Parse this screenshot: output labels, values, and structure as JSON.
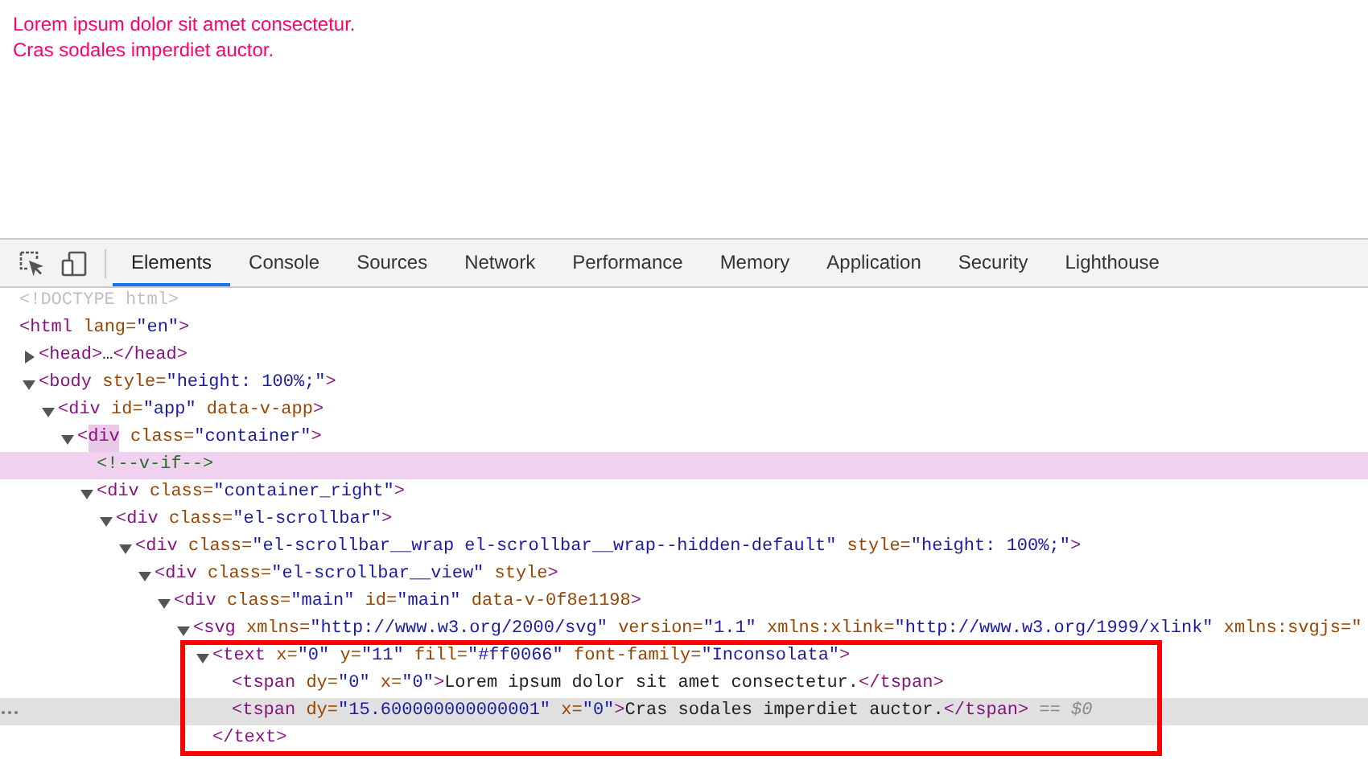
{
  "preview": {
    "lines": [
      "Lorem ipsum dolor sit amet consectetur.",
      "Cras sodales imperdiet auctor."
    ]
  },
  "devtools": {
    "tabs": [
      {
        "label": "Elements",
        "selected": true
      },
      {
        "label": "Console",
        "selected": false
      },
      {
        "label": "Sources",
        "selected": false
      },
      {
        "label": "Network",
        "selected": false
      },
      {
        "label": "Performance",
        "selected": false
      },
      {
        "label": "Memory",
        "selected": false
      },
      {
        "label": "Application",
        "selected": false
      },
      {
        "label": "Security",
        "selected": false
      },
      {
        "label": "Lighthouse",
        "selected": false
      }
    ],
    "nodes": [
      {
        "tokens": [
          {
            "kind": "doctype",
            "text": "<!DOCTYPE html>"
          }
        ],
        "selected": false,
        "hovered": false
      },
      {
        "tokens": [
          {
            "kind": "tag",
            "text": "<html"
          },
          {
            "kind": "attr",
            "text": " lang="
          },
          {
            "kind": "value",
            "text": "\"en\""
          },
          {
            "kind": "tag",
            "text": ">"
          }
        ],
        "selected": false,
        "hovered": false,
        "children": [
          {
            "tokens": [
              {
                "kind": "tag",
                "text": "<head>"
              },
              {
                "kind": "text",
                "text": "…"
              },
              {
                "kind": "tag",
                "text": "</head>"
              }
            ],
            "expanded": false,
            "selected": false,
            "hovered": false
          },
          {
            "tokens": [
              {
                "kind": "tag",
                "text": "<body"
              },
              {
                "kind": "attr",
                "text": " style="
              },
              {
                "kind": "value",
                "text": "\"height: 100%;\""
              },
              {
                "kind": "tag",
                "text": ">"
              }
            ],
            "expanded": true,
            "selected": false,
            "hovered": false,
            "children": [
              {
                "tokens": [
                  {
                    "kind": "tag",
                    "text": "<div"
                  },
                  {
                    "kind": "attr",
                    "text": " id="
                  },
                  {
                    "kind": "value",
                    "text": "\"app\""
                  },
                  {
                    "kind": "attr",
                    "text": " data-v-app"
                  },
                  {
                    "kind": "tag",
                    "text": ">"
                  }
                ],
                "expanded": true,
                "selected": false,
                "hovered": false,
                "children": [
                  {
                    "tokens": [
                      {
                        "kind": "tag",
                        "text": "<"
                      },
                      {
                        "kind": "tag_marked",
                        "text": "div"
                      },
                      {
                        "kind": "attr",
                        "text": " class="
                      },
                      {
                        "kind": "value",
                        "text": "\"container\""
                      },
                      {
                        "kind": "tag",
                        "text": ">"
                      }
                    ],
                    "expanded": true,
                    "selected": false,
                    "hovered": false,
                    "children": [
                      {
                        "tokens": [
                          {
                            "kind": "comment",
                            "text": "<!--v-if-->"
                          }
                        ],
                        "selected": false,
                        "hovered": true
                      },
                      {
                        "tokens": [
                          {
                            "kind": "tag",
                            "text": "<div"
                          },
                          {
                            "kind": "attr",
                            "text": " class="
                          },
                          {
                            "kind": "value",
                            "text": "\"container_right\""
                          },
                          {
                            "kind": "tag",
                            "text": ">"
                          }
                        ],
                        "expanded": true,
                        "selected": false,
                        "hovered": false,
                        "children": [
                          {
                            "tokens": [
                              {
                                "kind": "tag",
                                "text": "<div"
                              },
                              {
                                "kind": "attr",
                                "text": " class="
                              },
                              {
                                "kind": "value",
                                "text": "\"el-scrollbar\""
                              },
                              {
                                "kind": "tag",
                                "text": ">"
                              }
                            ],
                            "expanded": true,
                            "selected": false,
                            "hovered": false,
                            "children": [
                              {
                                "tokens": [
                                  {
                                    "kind": "tag",
                                    "text": "<div"
                                  },
                                  {
                                    "kind": "attr",
                                    "text": " class="
                                  },
                                  {
                                    "kind": "value",
                                    "text": "\"el-scrollbar__wrap el-scrollbar__wrap--hidden-default\""
                                  },
                                  {
                                    "kind": "attr",
                                    "text": " style="
                                  },
                                  {
                                    "kind": "value",
                                    "text": "\"height: 100%;\""
                                  },
                                  {
                                    "kind": "tag",
                                    "text": ">"
                                  }
                                ],
                                "expanded": true,
                                "selected": false,
                                "hovered": false,
                                "children": [
                                  {
                                    "tokens": [
                                      {
                                        "kind": "tag",
                                        "text": "<div"
                                      },
                                      {
                                        "kind": "attr",
                                        "text": " class="
                                      },
                                      {
                                        "kind": "value",
                                        "text": "\"el-scrollbar__view\""
                                      },
                                      {
                                        "kind": "attr",
                                        "text": " style"
                                      },
                                      {
                                        "kind": "tag",
                                        "text": ">"
                                      }
                                    ],
                                    "expanded": true,
                                    "selected": false,
                                    "hovered": false,
                                    "children": [
                                      {
                                        "tokens": [
                                          {
                                            "kind": "tag",
                                            "text": "<div"
                                          },
                                          {
                                            "kind": "attr",
                                            "text": " class="
                                          },
                                          {
                                            "kind": "value",
                                            "text": "\"main\""
                                          },
                                          {
                                            "kind": "attr",
                                            "text": " id="
                                          },
                                          {
                                            "kind": "value",
                                            "text": "\"main\""
                                          },
                                          {
                                            "kind": "attr",
                                            "text": " data-v-0f8e1198"
                                          },
                                          {
                                            "kind": "tag",
                                            "text": ">"
                                          }
                                        ],
                                        "expanded": true,
                                        "selected": false,
                                        "hovered": false,
                                        "children": [
                                          {
                                            "tokens": [
                                              {
                                                "kind": "tag",
                                                "text": "<svg"
                                              },
                                              {
                                                "kind": "attr",
                                                "text": " xmlns="
                                              },
                                              {
                                                "kind": "value",
                                                "text": "\"http://www.w3.org/2000/svg\""
                                              },
                                              {
                                                "kind": "attr",
                                                "text": " version="
                                              },
                                              {
                                                "kind": "value",
                                                "text": "\"1.1\""
                                              },
                                              {
                                                "kind": "attr",
                                                "text": " xmlns:xlink="
                                              },
                                              {
                                                "kind": "value",
                                                "text": "\"http://www.w3.org/1999/xlink\""
                                              },
                                              {
                                                "kind": "attr",
                                                "text": " xmlns:svgjs=\""
                                              }
                                            ],
                                            "expanded": true,
                                            "selected": false,
                                            "hovered": false,
                                            "children": [
                                              {
                                                "tokens": [
                                                  {
                                                    "kind": "tag",
                                                    "text": "<text"
                                                  },
                                                  {
                                                    "kind": "attr",
                                                    "text": " x="
                                                  },
                                                  {
                                                    "kind": "value",
                                                    "text": "\"0\""
                                                  },
                                                  {
                                                    "kind": "attr",
                                                    "text": " y="
                                                  },
                                                  {
                                                    "kind": "value",
                                                    "text": "\"11\""
                                                  },
                                                  {
                                                    "kind": "attr",
                                                    "text": " fill="
                                                  },
                                                  {
                                                    "kind": "value",
                                                    "text": "\"#ff0066\""
                                                  },
                                                  {
                                                    "kind": "attr",
                                                    "text": " font-family="
                                                  },
                                                  {
                                                    "kind": "value",
                                                    "text": "\"Inconsolata\""
                                                  },
                                                  {
                                                    "kind": "tag",
                                                    "text": ">"
                                                  }
                                                ],
                                                "expanded": true,
                                                "selected": false,
                                                "hovered": false,
                                                "boxed": true,
                                                "close_tokens": [
                                                  {
                                                    "kind": "tag",
                                                    "text": "</text>"
                                                  }
                                                ],
                                                "children": [
                                                  {
                                                    "tokens": [
                                                      {
                                                        "kind": "tag",
                                                        "text": "<tspan"
                                                      },
                                                      {
                                                        "kind": "attr",
                                                        "text": " dy="
                                                      },
                                                      {
                                                        "kind": "value",
                                                        "text": "\"0\""
                                                      },
                                                      {
                                                        "kind": "attr",
                                                        "text": " x="
                                                      },
                                                      {
                                                        "kind": "value",
                                                        "text": "\"0\""
                                                      },
                                                      {
                                                        "kind": "tag",
                                                        "text": ">"
                                                      },
                                                      {
                                                        "kind": "text",
                                                        "text": "Lorem ipsum dolor sit amet consectetur."
                                                      },
                                                      {
                                                        "kind": "tag",
                                                        "text": "</tspan>"
                                                      }
                                                    ],
                                                    "selected": false,
                                                    "hovered": false
                                                  },
                                                  {
                                                    "tokens": [
                                                      {
                                                        "kind": "tag",
                                                        "text": "<tspan"
                                                      },
                                                      {
                                                        "kind": "attr",
                                                        "text": " dy="
                                                      },
                                                      {
                                                        "kind": "value",
                                                        "text": "\"15.600000000000001\""
                                                      },
                                                      {
                                                        "kind": "attr",
                                                        "text": " x="
                                                      },
                                                      {
                                                        "kind": "value",
                                                        "text": "\"0\""
                                                      },
                                                      {
                                                        "kind": "tag",
                                                        "text": ">"
                                                      },
                                                      {
                                                        "kind": "text",
                                                        "text": "Cras sodales imperdiet auctor."
                                                      },
                                                      {
                                                        "kind": "tag",
                                                        "text": "</tspan>"
                                                      },
                                                      {
                                                        "kind": "hint",
                                                        "text": " == $0"
                                                      }
                                                    ],
                                                    "selected": true,
                                                    "hovered": false
                                                  }
                                                ]
                                              }
                                            ]
                                          }
                                        ]
                                      }
                                    ]
                                  }
                                ]
                              }
                            ]
                          }
                        ]
                      }
                    ]
                  }
                ]
              }
            ]
          }
        ]
      }
    ]
  }
}
